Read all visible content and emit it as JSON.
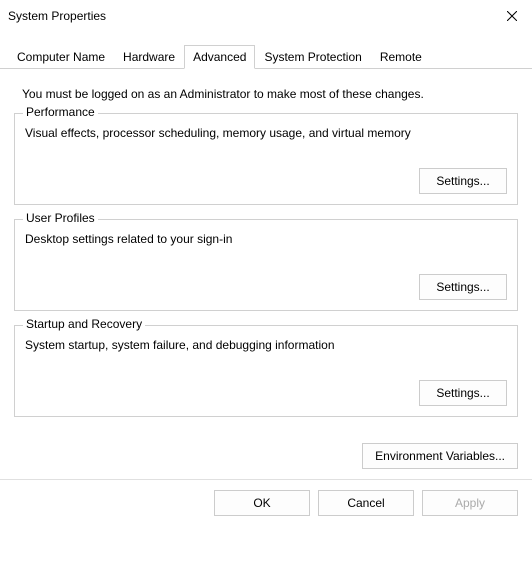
{
  "window": {
    "title": "System Properties"
  },
  "tabs": {
    "computer_name": "Computer Name",
    "hardware": "Hardware",
    "advanced": "Advanced",
    "system_protection": "System Protection",
    "remote": "Remote"
  },
  "intro": "You must be logged on as an Administrator to make most of these changes.",
  "groups": {
    "performance": {
      "label": "Performance",
      "desc": "Visual effects, processor scheduling, memory usage, and virtual memory",
      "button": "Settings..."
    },
    "user_profiles": {
      "label": "User Profiles",
      "desc": "Desktop settings related to your sign-in",
      "button": "Settings..."
    },
    "startup_recovery": {
      "label": "Startup and Recovery",
      "desc": "System startup, system failure, and debugging information",
      "button": "Settings..."
    }
  },
  "env_button": "Environment Variables...",
  "footer": {
    "ok": "OK",
    "cancel": "Cancel",
    "apply": "Apply"
  }
}
